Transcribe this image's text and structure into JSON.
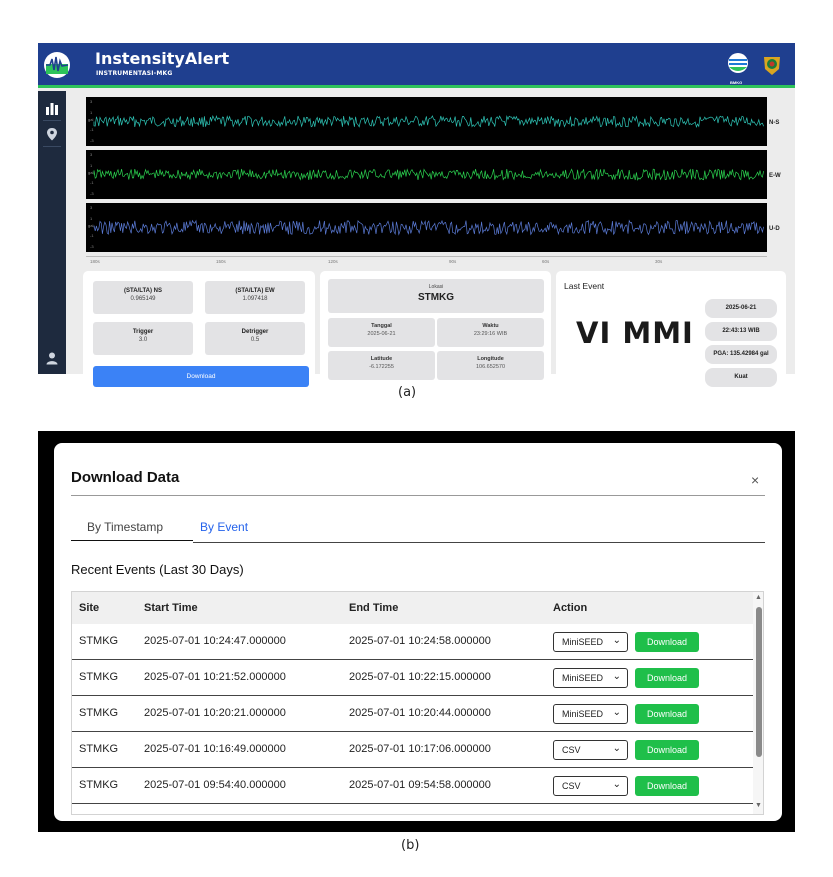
{
  "app": {
    "title": "InstensityAlert",
    "subtitle": "INSTRUMENTASI-MKG",
    "bmkg_text": "BMKG"
  },
  "colors": {
    "header": "#1f3f8f",
    "accent": "#2dc35a",
    "trace_ns": "#2ec4b6",
    "trace_ew": "#2bd14f",
    "trace_ud": "#5b7bd6",
    "download_blue": "#3b82f6",
    "download_green": "#1fbf4a"
  },
  "sidebar": {
    "icons": [
      "bar-chart-icon",
      "map-pin-icon",
      "user-icon"
    ]
  },
  "waveforms": {
    "y_ticks": [
      "3",
      "1",
      "-1",
      "-3"
    ],
    "y_unit": "gal",
    "channels": [
      "N-S",
      "E-W",
      "U-D"
    ],
    "x_ticks": [
      "180s",
      "150s",
      "120s",
      "90s",
      "60s",
      "30s"
    ]
  },
  "stats": {
    "sta_lta_ns_label": "(STA/LTA) NS",
    "sta_lta_ns_value": "0.965149",
    "sta_lta_ew_label": "(STA/LTA) EW",
    "sta_lta_ew_value": "1.097418",
    "trigger_label": "Trigger",
    "trigger_value": "3.0",
    "detrigger_label": "Detrigger",
    "detrigger_value": "0.5",
    "download_label": "Download"
  },
  "location": {
    "lokasi_label": "Lokasi",
    "lokasi_value": "STMKG",
    "tanggal_label": "Tanggal",
    "tanggal_value": "2025-06-21",
    "waktu_label": "Waktu",
    "waktu_value": "23:29:16 WIB",
    "latitude_label": "Latitude",
    "latitude_value": "-6.172255",
    "longitude_label": "Longitude",
    "longitude_value": "106.652570"
  },
  "last_event": {
    "title": "Last Event",
    "mmi": "VI MMI",
    "date": "2025-06-21",
    "time": "22:43:13 WIB",
    "pga": "PGA: 135.42984 gal",
    "category": "Kuat"
  },
  "captions": {
    "a": "(a)",
    "b": "(b)"
  },
  "modal": {
    "title": "Download Data",
    "close": "×",
    "tabs": [
      "By Timestamp",
      "By Event"
    ],
    "active_tab": "By Event",
    "section_title": "Recent Events (Last 30 Days)",
    "columns": [
      "Site",
      "Start Time",
      "End Time",
      "Action"
    ],
    "rows": [
      {
        "site": "STMKG",
        "start": "2025-07-01 10:24:47.000000",
        "end": "2025-07-01 10:24:58.000000",
        "format": "MiniSEED",
        "action": "Download"
      },
      {
        "site": "STMKG",
        "start": "2025-07-01 10:21:52.000000",
        "end": "2025-07-01 10:22:15.000000",
        "format": "MiniSEED",
        "action": "Download"
      },
      {
        "site": "STMKG",
        "start": "2025-07-01 10:20:21.000000",
        "end": "2025-07-01 10:20:44.000000",
        "format": "MiniSEED",
        "action": "Download"
      },
      {
        "site": "STMKG",
        "start": "2025-07-01 10:16:49.000000",
        "end": "2025-07-01 10:17:06.000000",
        "format": "CSV",
        "action": "Download"
      },
      {
        "site": "STMKG",
        "start": "2025-07-01 09:54:40.000000",
        "end": "2025-07-01 09:54:58.000000",
        "format": "CSV",
        "action": "Download"
      }
    ]
  }
}
